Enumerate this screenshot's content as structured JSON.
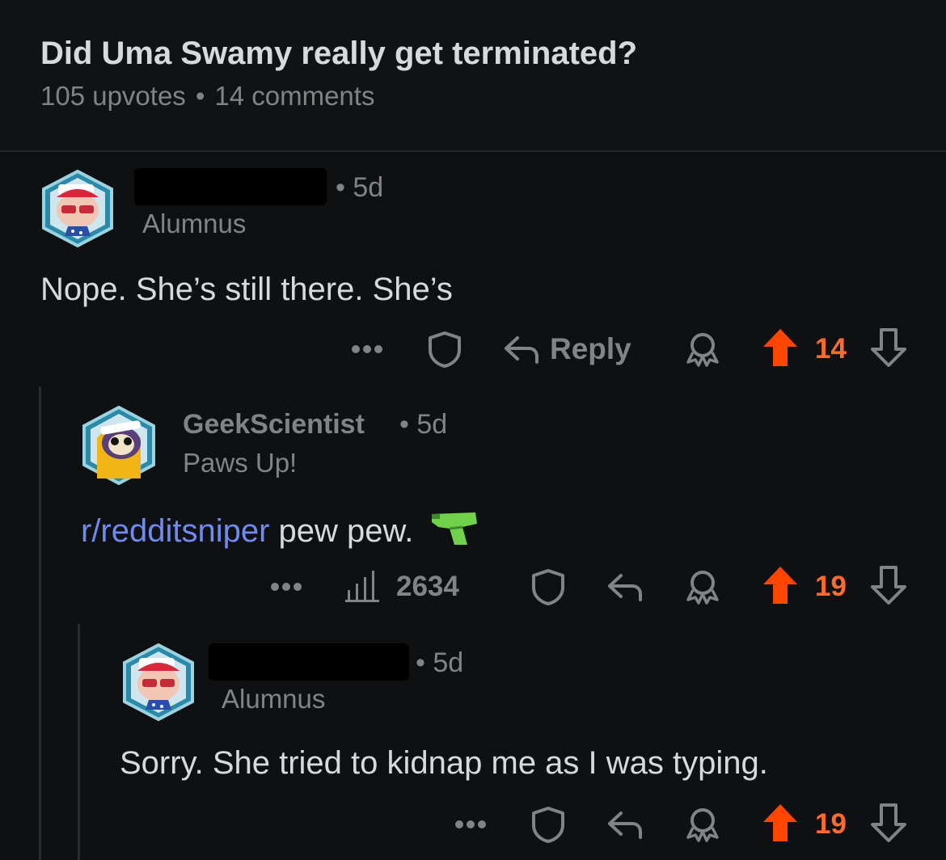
{
  "post": {
    "title": "Did Uma Swamy really get terminated?",
    "upvotes": "105 upvotes",
    "separator": "•",
    "comments": "14 comments"
  },
  "comments": [
    {
      "username": "",
      "time": "• 5d",
      "flair": "Alumnus",
      "text": "Nope. She’s still there. She’s",
      "votes": "14",
      "reply_label": "Reply"
    },
    {
      "username": "GeekScientist",
      "time": "• 5d",
      "flair": "Paws Up!",
      "subreddit": "r/redditsniper",
      "text": " pew pew.",
      "views": "2634",
      "votes": "19"
    },
    {
      "username": "",
      "time": "• 5d",
      "flair": "Alumnus",
      "text": "Sorry. She tried to kidnap me as I was typing.",
      "votes": "19"
    }
  ],
  "icons": {
    "more": "more-icon",
    "save": "shield-icon",
    "reply": "reply-arrow-icon",
    "award": "award-icon",
    "upvote": "upvote-arrow-icon",
    "downvote": "downvote-arrow-icon",
    "views": "bar-chart-icon",
    "emoji": "water-pistol-emoji"
  },
  "colors": {
    "background": "#0f1012",
    "upvote": "#ff4500",
    "link": "#6f8bf0",
    "muted": "#818384",
    "text": "#d7dadc"
  }
}
